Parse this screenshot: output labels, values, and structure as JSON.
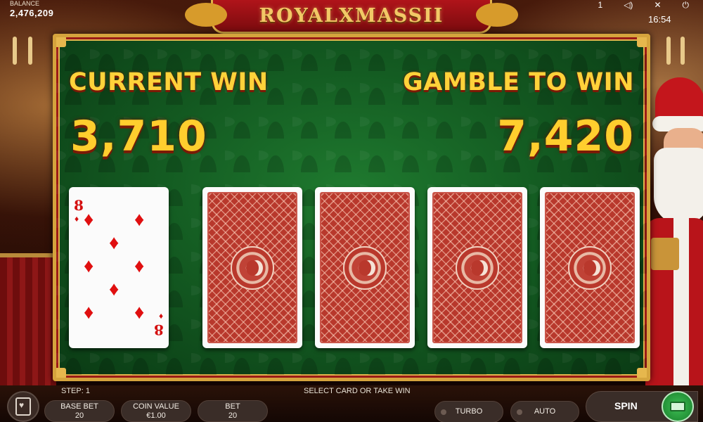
{
  "game": {
    "title": "ROYALXMASSII"
  },
  "hud": {
    "balance_label": "BALANCE",
    "balance_value": "2,476,209",
    "time": "16:54",
    "notification_count": "1"
  },
  "gamble": {
    "current_win_label": "CURRENT WIN",
    "current_win_value": "3,710",
    "gamble_to_win_label": "GAMBLE TO WIN",
    "gamble_to_win_value": "7,420",
    "revealed_card": {
      "rank": "8",
      "suit": "diamonds",
      "suit_symbol": "♦"
    },
    "face_down_cards": 4
  },
  "bottom_bar": {
    "step": "STEP: 1",
    "status": "SELECT CARD OR TAKE WIN",
    "base_bet_label": "BASE BET",
    "base_bet_value": "20",
    "coin_value_label": "COIN VALUE",
    "coin_value_value": "€1.00",
    "bet_label": "BET",
    "bet_value": "20",
    "turbo_label": "TURBO",
    "auto_label": "AUTO",
    "spin_label": "SPIN"
  },
  "colors": {
    "gold_text": "#ffd23a",
    "felt_green": "#145c22",
    "card_back_red": "#b8382c",
    "spin_green": "#2ea043"
  }
}
